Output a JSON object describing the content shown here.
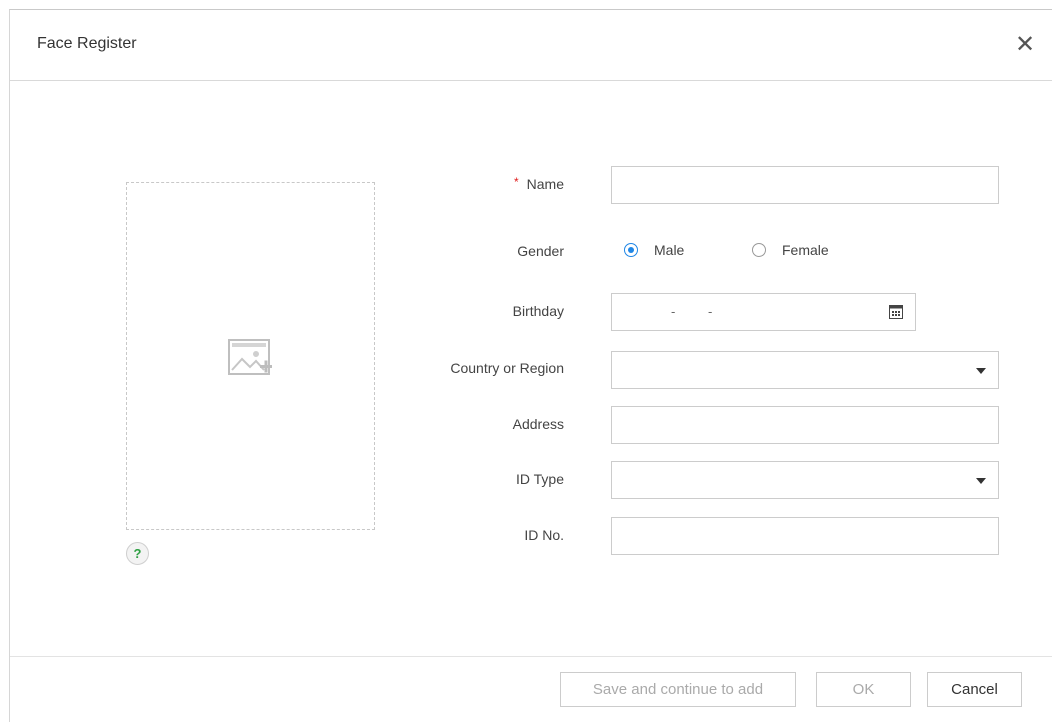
{
  "dialog": {
    "title": "Face Register",
    "close_icon": "close-icon",
    "photo": {
      "icon": "add-image-icon",
      "help_glyph": "?"
    }
  },
  "form": {
    "name": {
      "label": "Name",
      "required_mark": "*",
      "value": ""
    },
    "gender": {
      "label": "Gender",
      "options": [
        "Male",
        "Female"
      ],
      "selected": "Male"
    },
    "birthday": {
      "label": "Birthday",
      "sep1": "-",
      "sep2": "-",
      "icon": "calendar-icon"
    },
    "country": {
      "label": "Country or Region",
      "value": ""
    },
    "address": {
      "label": "Address",
      "value": ""
    },
    "id_type": {
      "label": "ID Type",
      "value": ""
    },
    "id_no": {
      "label": "ID No.",
      "value": ""
    }
  },
  "footer": {
    "save_continue": "Save and continue to add",
    "ok": "OK",
    "cancel": "Cancel"
  },
  "colors": {
    "accent": "#1f86e6",
    "required": "#e01b1b",
    "help": "#2ea043"
  }
}
